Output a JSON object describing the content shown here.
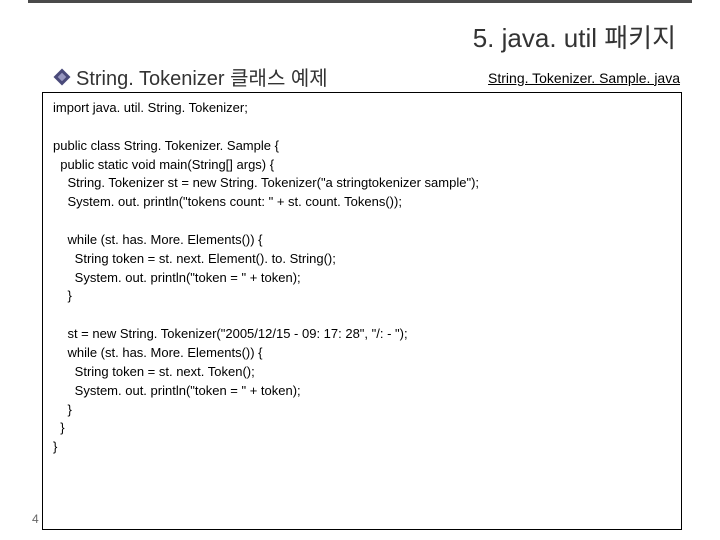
{
  "slide": {
    "title": "5. java. util 패키지",
    "subtitle": "String. Tokenizer 클래스 예제",
    "filename": "String. Tokenizer. Sample. java",
    "page_number": "4"
  },
  "code": {
    "line01": "import java. util. String. Tokenizer;",
    "line02": "",
    "line03": "public class String. Tokenizer. Sample {",
    "line04": "  public static void main(String[] args) {",
    "line05": "    String. Tokenizer st = new String. Tokenizer(\"a stringtokenizer sample\");",
    "line06": "    System. out. println(\"tokens count: \" + st. count. Tokens());",
    "line07": "",
    "line08": "    while (st. has. More. Elements()) {",
    "line09": "      String token = st. next. Element(). to. String();",
    "line10": "      System. out. println(\"token = \" + token);",
    "line11": "    }",
    "line12": "",
    "line13": "    st = new String. Tokenizer(\"2005/12/15 - 09: 17: 28\", \"/: - \");",
    "line14": "    while (st. has. More. Elements()) {",
    "line15": "      String token = st. next. Token();",
    "line16": "      System. out. println(\"token = \" + token);",
    "line17": "    }",
    "line18": "  }",
    "line19": "}"
  }
}
